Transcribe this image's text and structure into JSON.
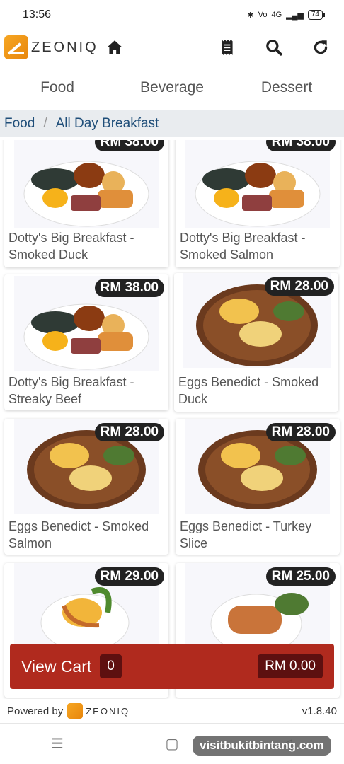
{
  "status": {
    "time": "13:56",
    "network": "4G",
    "battery": "74"
  },
  "header": {
    "brand": "ZEONIQ"
  },
  "tabs": [
    "Food",
    "Beverage",
    "Dessert"
  ],
  "breadcrumb": {
    "root": "Food",
    "current": "All Day Breakfast"
  },
  "items": [
    {
      "name": "Dotty's Big Breakfast - Smoked Duck",
      "price": "RM 38.00"
    },
    {
      "name": "Dotty's Big Breakfast - Smoked Salmon",
      "price": "RM 38.00"
    },
    {
      "name": "Dotty's Big Breakfast - Streaky Beef",
      "price": "RM 38.00"
    },
    {
      "name": "Eggs Benedict - Smoked Duck",
      "price": "RM 28.00"
    },
    {
      "name": "Eggs Benedict - Smoked Salmon",
      "price": "RM 28.00"
    },
    {
      "name": "Eggs Benedict - Turkey Slice",
      "price": "RM 28.00"
    },
    {
      "name": "",
      "price": "RM 29.00"
    },
    {
      "name": "",
      "price": "RM 25.00"
    }
  ],
  "cart": {
    "label": "View Cart",
    "count": "0",
    "total": "RM 0.00"
  },
  "footer": {
    "powered_by": "Powered by",
    "brand": "ZEONIQ",
    "version": "v1.8.40"
  },
  "watermark": "visitbukitbintang.com",
  "colors": {
    "cart_bg": "#b02a1e",
    "price_bg": "#222222",
    "breadcrumb_text": "#1f4e79"
  }
}
